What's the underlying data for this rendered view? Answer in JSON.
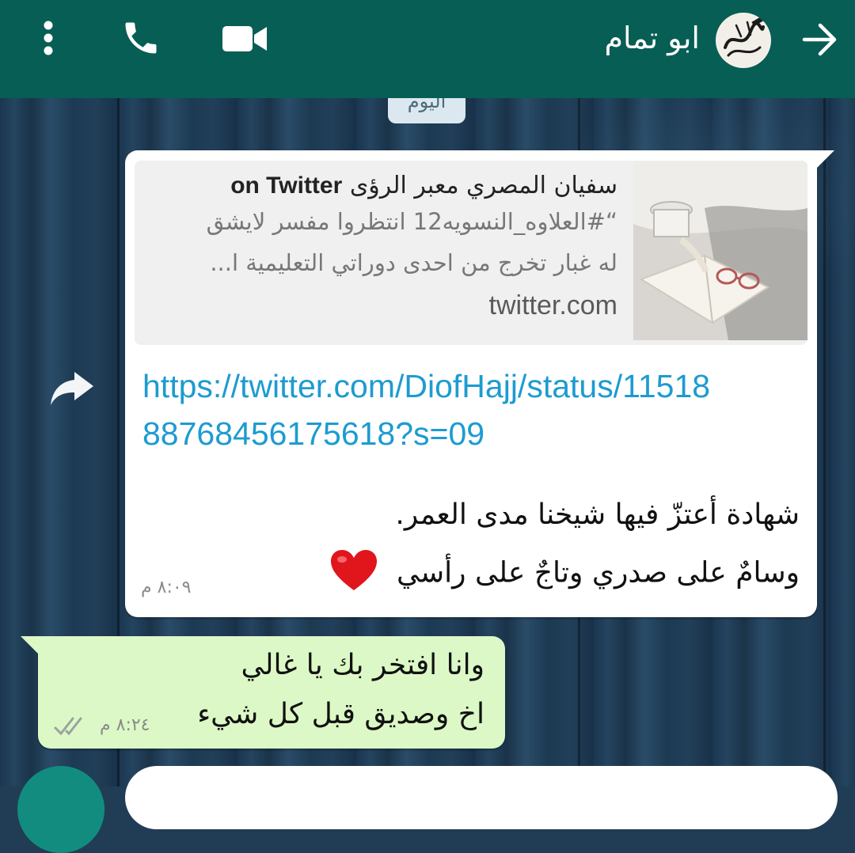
{
  "header": {
    "contact_name": "ابو تمام",
    "color": "#075e54"
  },
  "date_chip": {
    "label": "اليوم"
  },
  "incoming": {
    "preview": {
      "title_ar": "سفيان المصري معبر الرؤى",
      "title_en": "on Twitter",
      "desc_line1": "“#العلاوه_النسويه12 انتظروا مفسر لايشق",
      "desc_line2": "له غبار تخرج من احدى دوراتي التعليمية ا...",
      "host": "twitter.com"
    },
    "link": "https://twitter.com/DiofHajj/status/1151888768456175618?s=09",
    "line1": "شهادة أعتزّ فيها شيخنا مدى العمر.",
    "line2": "وسامٌ على صدري وتاجٌ على رأسي",
    "time": "٨:٠٩ م"
  },
  "outgoing": {
    "line1": "وانا افتخر بك يا غالي",
    "line2": "اخ وصديق قبل كل شيء",
    "time": "٨:٢٤ م",
    "status_icon": "double-check-icon"
  },
  "colors": {
    "link": "#1d9bd1",
    "outgoing_bubble": "#dcf8c6",
    "accent": "#128c7e"
  }
}
